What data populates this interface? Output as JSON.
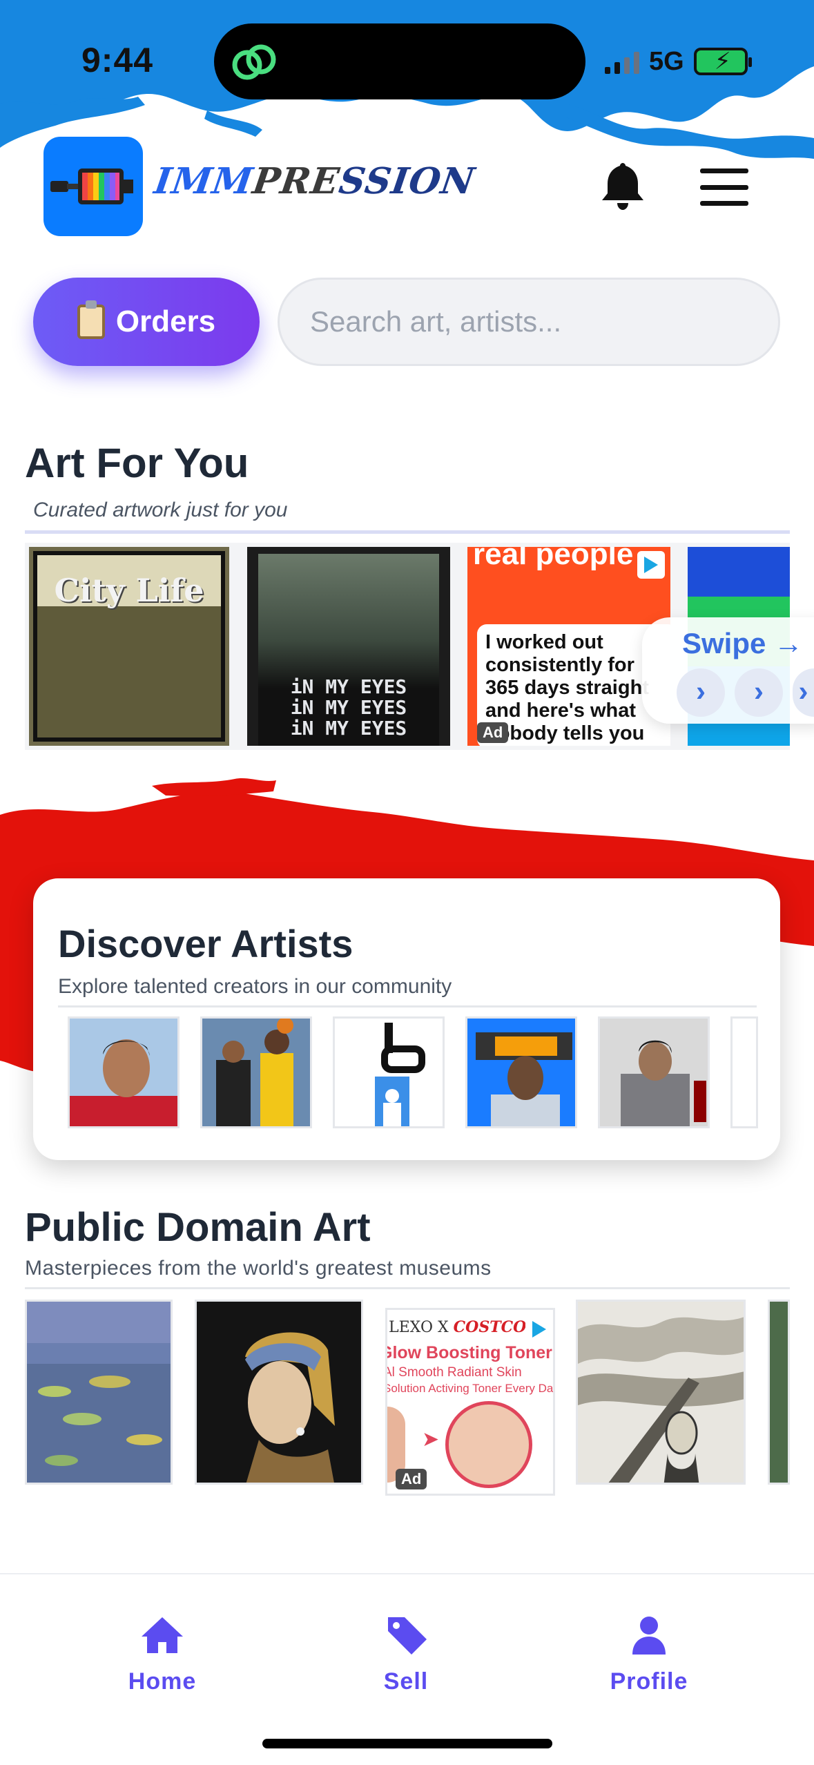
{
  "status_bar": {
    "time": "9:44",
    "network": "5G"
  },
  "header": {
    "brand": "IMMPRESSION",
    "brand_parts": [
      "IMM",
      "PRE",
      "SSION"
    ],
    "logo_color": "#0A7CFF"
  },
  "actions": {
    "orders_label": "Orders",
    "search_placeholder": "Search art, artists..."
  },
  "art_for_you": {
    "title": "Art For You",
    "subtitle": "Curated artwork just for you",
    "tiles": [
      {
        "kind": "artwork",
        "text": "City Life"
      },
      {
        "kind": "artwork",
        "text": "iN MY EYES\niN MY EYES\niN MY EYES"
      },
      {
        "kind": "ad",
        "headline": "real people",
        "body": "I worked out consistently for 365 days straight and here's what nobody tells you",
        "badge": "Ad"
      },
      {
        "kind": "artwork"
      }
    ],
    "swipe": {
      "label": "Swipe →",
      "chevrons": [
        "›",
        "›",
        "›"
      ]
    }
  },
  "discover_artists": {
    "title": "Discover Artists",
    "subtitle": "Explore talented creators in our community",
    "artists": [
      "artist-1",
      "artist-2",
      "artist-3",
      "artist-4",
      "artist-5",
      "artist-6"
    ]
  },
  "public_domain": {
    "title": "Public Domain Art",
    "subtitle": "Masterpieces from the world's greatest museums",
    "ad": {
      "brand_left": "LEXO X",
      "brand_right": "COSTCO",
      "headline": "Glow Boosting Toner",
      "line1": "Al Smooth Radiant Skin",
      "line2": "Solution Activing Toner Every Day",
      "badge": "Ad"
    }
  },
  "bottom_nav": {
    "items": [
      {
        "label": "Home"
      },
      {
        "label": "Sell"
      },
      {
        "label": "Profile"
      }
    ],
    "accent": "#5B4CF0"
  },
  "colors": {
    "accent": "#6D5CF6",
    "paint_blue": "#1787E0",
    "paint_red": "#E3120B"
  }
}
